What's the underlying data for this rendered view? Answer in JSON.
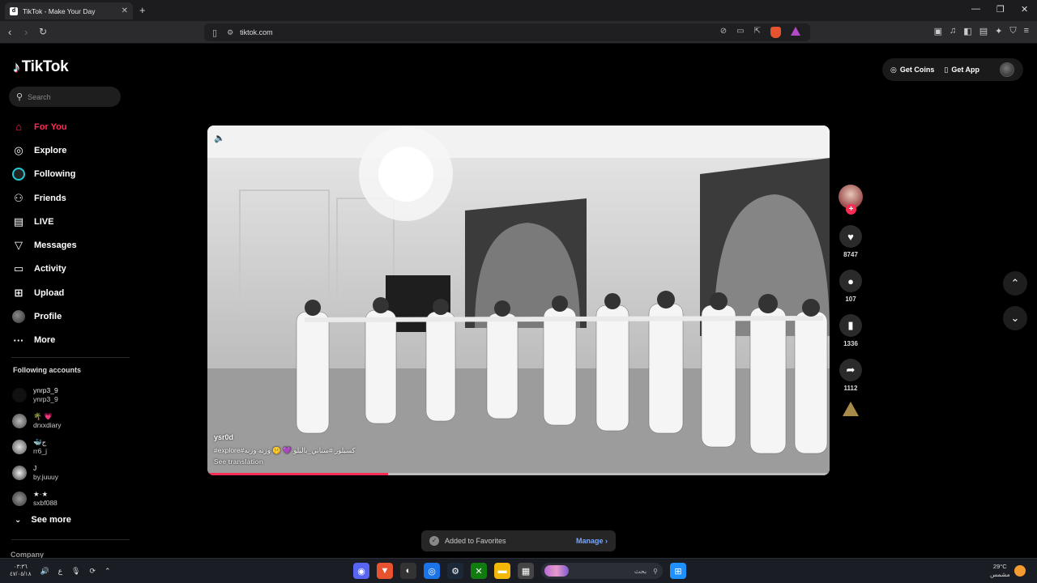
{
  "browser": {
    "tab_title": "TikTok - Make Your Day",
    "tab_favicon": "d",
    "url": "tiktok.com",
    "accent_shield": "#e8532f"
  },
  "sidebar": {
    "logo_text": "TikTok",
    "search_placeholder": "Search",
    "nav": [
      {
        "label": "For You",
        "icon": "home-icon"
      },
      {
        "label": "Explore",
        "icon": "compass-icon"
      },
      {
        "label": "Following",
        "icon": "following-avatar-icon"
      },
      {
        "label": "Friends",
        "icon": "friends-icon"
      },
      {
        "label": "LIVE",
        "icon": "live-icon"
      },
      {
        "label": "Messages",
        "icon": "messages-icon"
      },
      {
        "label": "Activity",
        "icon": "activity-icon"
      },
      {
        "label": "Upload",
        "icon": "upload-icon"
      },
      {
        "label": "Profile",
        "icon": "profile-avatar-icon"
      },
      {
        "label": "More",
        "icon": "more-icon"
      }
    ],
    "following_title": "Following accounts",
    "following": [
      {
        "name": "ynrp3_9",
        "handle": "ynrp3_9"
      },
      {
        "name": "🌴 💗",
        "handle": "drxxdiary"
      },
      {
        "name": "🐳ج",
        "handle": "rr6_j"
      },
      {
        "name": "J",
        "handle": "by.juuuy"
      },
      {
        "name": "★·★",
        "handle": "sxbf088"
      }
    ],
    "see_more": "See more",
    "company": "Company"
  },
  "topright": {
    "get_coins": "Get Coins",
    "get_app": "Get App"
  },
  "video": {
    "username": "ysr0d",
    "caption": "#explore#كسبلور #سناني_بالبلو 💜 🤫 وزنه وزنه",
    "see_translation": "See translation",
    "progress": 0.29
  },
  "actions": {
    "likes": "8747",
    "comments": "107",
    "saves": "1336",
    "shares": "1112"
  },
  "toast": {
    "message": "Added to Favorites",
    "manage": "Manage"
  },
  "taskbar": {
    "time": "٠٣:٣٦",
    "date": "٤٧/٠٥/١٨",
    "lang": "ع",
    "search_text": "بحث",
    "weather_temp": "29°C",
    "weather_desc": "مشمس"
  }
}
